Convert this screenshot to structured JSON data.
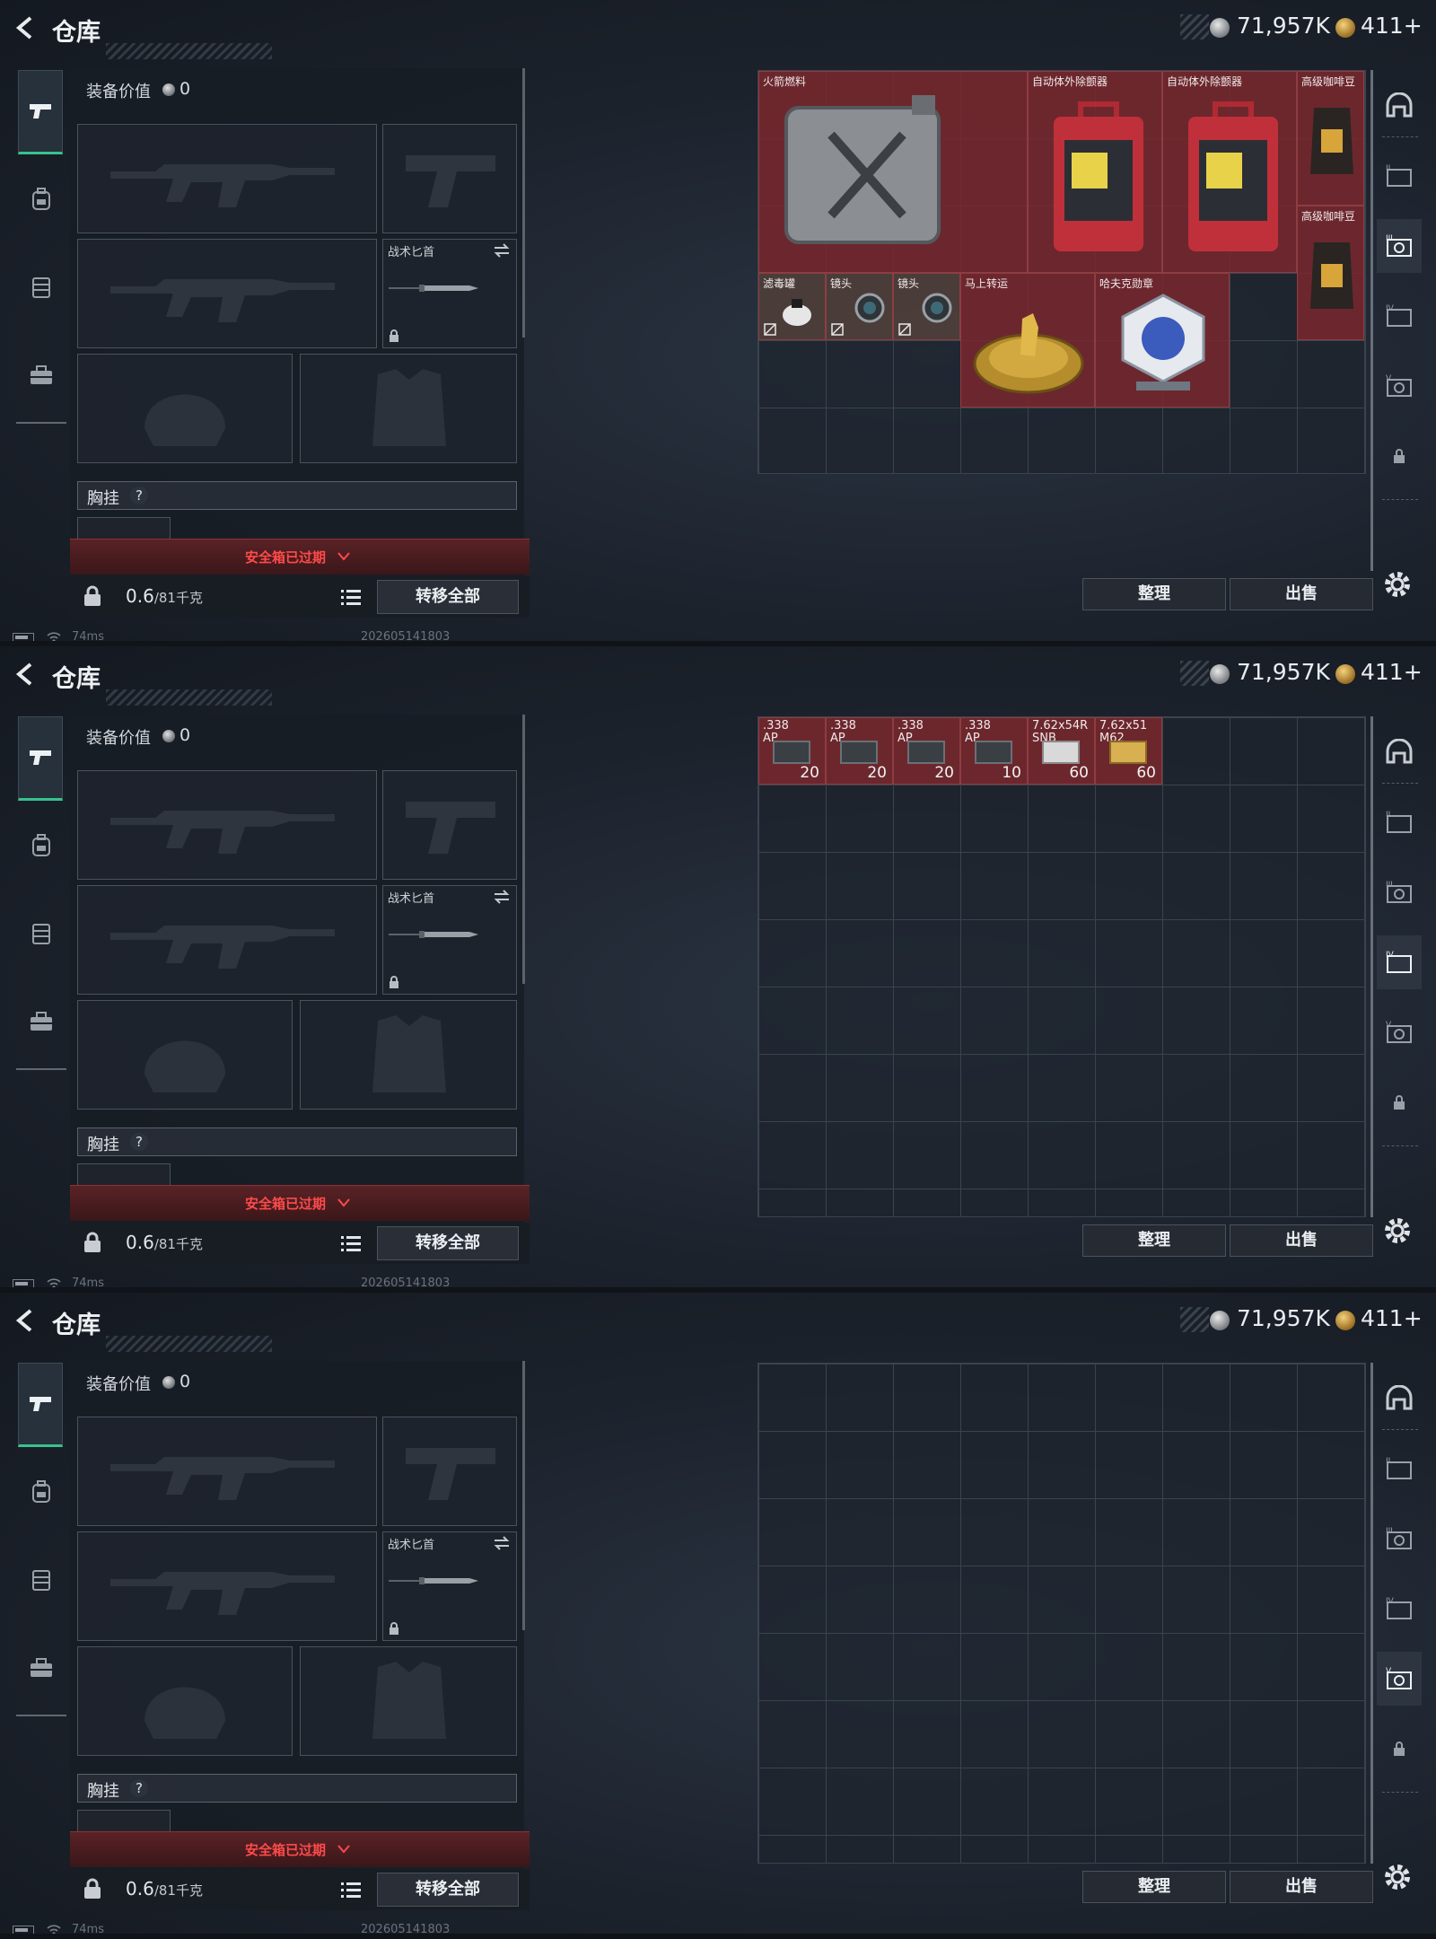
{
  "screens": [
    {
      "header": {
        "title": "仓库",
        "currency1": "71,957K",
        "currency2": "411+"
      },
      "equipment": {
        "value_label": "装备价值",
        "value": "0",
        "knife_label": "战术匕首",
        "chest_label": "胸挂",
        "chest_help": "?",
        "safebox_expired": "安全箱已过期",
        "weight": "0.6",
        "weight_unit": "/81千克",
        "transfer_all": "转移全部"
      },
      "stash": {
        "items": [
          {
            "name": "火箭燃料"
          },
          {
            "name": "自动体外除颤器"
          },
          {
            "name": "自动体外除颤器"
          },
          {
            "name": "高级咖啡豆"
          },
          {
            "name": "高级咖啡豆"
          },
          {
            "name": "滤毒罐"
          },
          {
            "name": "镜头"
          },
          {
            "name": "镜头"
          },
          {
            "name": "马上转运"
          },
          {
            "name": "哈夫克勋章"
          }
        ]
      },
      "buttons": {
        "sort": "整理",
        "sell": "出售"
      },
      "status": {
        "ping": "74ms",
        "build": "202605141803"
      },
      "active_category": 3
    },
    {
      "header": {
        "title": "仓库",
        "currency1": "71,957K",
        "currency2": "411+"
      },
      "equipment": {
        "value_label": "装备价值",
        "value": "0",
        "knife_label": "战术匕首",
        "chest_label": "胸挂",
        "chest_help": "?",
        "safebox_expired": "安全箱已过期",
        "weight": "0.6",
        "weight_unit": "/81千克",
        "transfer_all": "转移全部"
      },
      "stash": {
        "ammo": [
          {
            "caliber": ".338\nAP",
            "count": "20"
          },
          {
            "caliber": ".338\nAP",
            "count": "20"
          },
          {
            "caliber": ".338\nAP",
            "count": "20"
          },
          {
            "caliber": ".338\nAP",
            "count": "10"
          },
          {
            "caliber": "7.62x54R\nSNB",
            "count": "60"
          },
          {
            "caliber": "7.62x51\nM62",
            "count": "60"
          }
        ]
      },
      "buttons": {
        "sort": "整理",
        "sell": "出售"
      },
      "status": {
        "ping": "74ms",
        "build": "202605141803"
      },
      "active_category": 4
    },
    {
      "header": {
        "title": "仓库",
        "currency1": "71,957K",
        "currency2": "411+"
      },
      "equipment": {
        "value_label": "装备价值",
        "value": "0",
        "knife_label": "战术匕首",
        "chest_label": "胸挂",
        "chest_help": "?",
        "safebox_expired": "安全箱已过期",
        "weight": "0.6",
        "weight_unit": "/81千克",
        "transfer_all": "转移全部"
      },
      "stash": {},
      "buttons": {
        "sort": "整理",
        "sell": "出售"
      },
      "status": {
        "ping": "74ms",
        "build": "202605141803"
      },
      "active_category": 5
    }
  ],
  "right_categories": [
    "helmet-icon",
    "stash-tab-ii-icon",
    "stash-tab-iii-icon",
    "stash-tab-iv-icon",
    "stash-tab-v-icon",
    "lock-icon"
  ],
  "colors": {
    "accent_green": "#37c28f",
    "item_red": "#7a282e",
    "warning_red": "#ff4a4a"
  }
}
